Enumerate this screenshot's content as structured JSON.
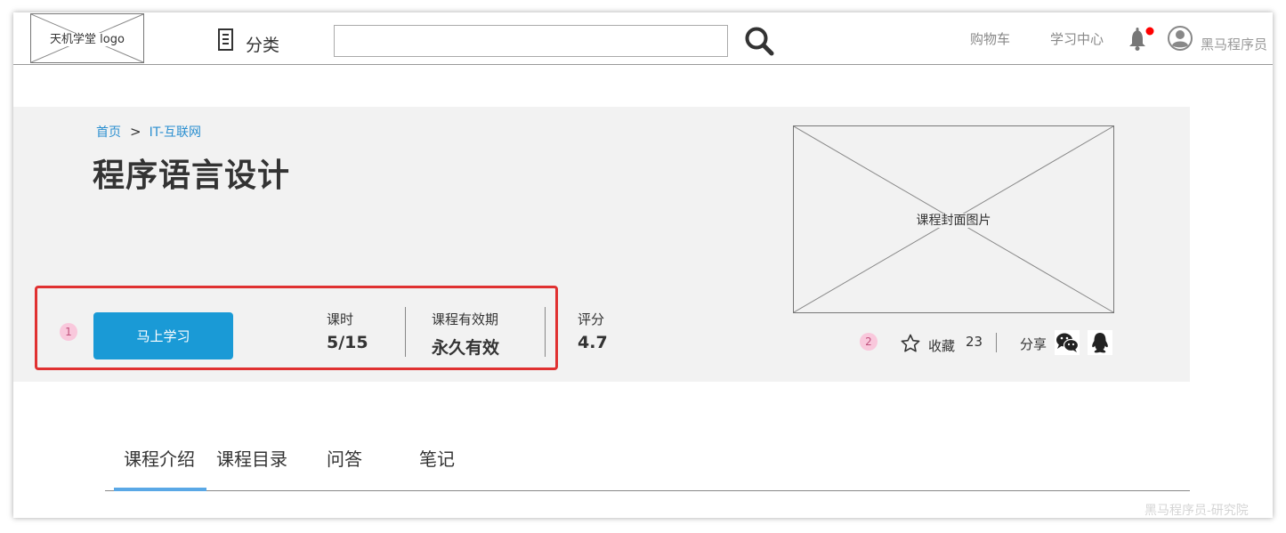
{
  "header": {
    "logo_text": "天机学堂 logo",
    "category_label": "分类",
    "search": {
      "value": "",
      "placeholder": ""
    },
    "nav": {
      "cart": "购物车",
      "learning_center": "学习中心"
    },
    "notification_dot_color": "#ff0000",
    "username": "黑马程序员"
  },
  "breadcrumb": {
    "home": "首页",
    "separator": ">",
    "category": "IT-互联网"
  },
  "course": {
    "title": "程序语言设计",
    "primary_button": "马上学习",
    "stats": [
      {
        "label": "课时",
        "value": "5/15"
      },
      {
        "label": "课程有效期",
        "value": "永久有效"
      },
      {
        "label": "评分",
        "value": "4.7"
      }
    ],
    "cover_label": "课程封面图片",
    "favorite_label": "收藏",
    "favorite_count": "23",
    "share_label": "分享",
    "share_icons": [
      "wechat-icon",
      "qq-icon"
    ]
  },
  "annotations": {
    "marker_1": "1",
    "marker_2": "2"
  },
  "tabs": [
    {
      "label": "课程介绍",
      "active": true
    },
    {
      "label": "课程目录",
      "active": false
    },
    {
      "label": "问答",
      "active": false
    },
    {
      "label": "笔记",
      "active": false
    }
  ],
  "colors": {
    "primary_button": "#1a9ad6",
    "link": "#2b8fd0",
    "highlight_border": "#e03131",
    "active_tab_bar": "#5aa8e6",
    "banner_bg": "#f2f2f2"
  },
  "watermark": "黑马程序员-研究院"
}
